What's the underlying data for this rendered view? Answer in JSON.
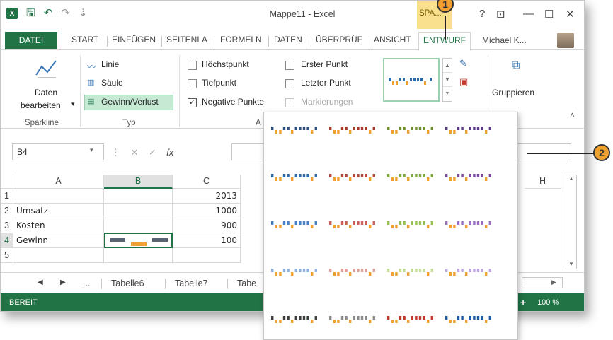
{
  "window": {
    "title": "Mappe11 - Excel",
    "context_label": "SPA...",
    "help": "?",
    "user": "Michael K...",
    "controls": [
      "—",
      "☐",
      "✕"
    ]
  },
  "qat": {
    "undo": "↶",
    "redo": "↷",
    "customize": "⇣"
  },
  "tabs": [
    {
      "label": "DATEI"
    },
    {
      "label": "START"
    },
    {
      "label": "EINFÜGEN"
    },
    {
      "label": "SEITENLA"
    },
    {
      "label": "FORMELN"
    },
    {
      "label": "DATEN"
    },
    {
      "label": "ÜBERPRÜF"
    },
    {
      "label": "ANSICHT"
    },
    {
      "label": "ENTWURF"
    }
  ],
  "ribbon": {
    "sparkline_group": {
      "edit_data": "Daten",
      "edit_data2": "bearbeiten",
      "label": "Sparkline"
    },
    "type_group": {
      "label": "Typ",
      "items": [
        {
          "label": "Linie",
          "icon": "line-chart-icon"
        },
        {
          "label": "Säule",
          "icon": "column-chart-icon"
        },
        {
          "label": "Gewinn/Verlust",
          "icon": "win-loss-icon"
        }
      ]
    },
    "show_group": {
      "label": "A",
      "checkboxes": [
        {
          "label": "Höchstpunkt",
          "checked": false,
          "disabled": false
        },
        {
          "label": "Tiefpunkt",
          "checked": false,
          "disabled": false
        },
        {
          "label": "Negative Punkte",
          "checked": true,
          "disabled": false
        },
        {
          "label": "Erster Punkt",
          "checked": false,
          "disabled": false
        },
        {
          "label": "Letzter Punkt",
          "checked": false,
          "disabled": false
        },
        {
          "label": "Markierungen",
          "checked": false,
          "disabled": true
        }
      ]
    },
    "group_label": "Gruppieren"
  },
  "formula_bar": {
    "namebox": "B4",
    "fx": "fx",
    "cancel": "✕",
    "enter": "✓"
  },
  "grid": {
    "columns": [
      "A",
      "B",
      "C",
      "H"
    ],
    "rows": [
      {
        "num": "1",
        "a": "",
        "c": "2013"
      },
      {
        "num": "2",
        "a": "Umsatz",
        "c": "1000"
      },
      {
        "num": "3",
        "a": "Kosten",
        "c": "900"
      },
      {
        "num": "4",
        "a": "Gewinn",
        "c": "100"
      },
      {
        "num": "5",
        "a": "",
        "c": ""
      }
    ]
  },
  "sheet_tabs": [
    "...",
    "Tabelle6",
    "Tabelle7",
    "Tabe"
  ],
  "status": {
    "text": "BEREIT",
    "zoom": "100 %",
    "plus": "+"
  },
  "callouts": [
    "1",
    "2"
  ],
  "colors": {
    "excel_green": "#217346",
    "gallery_rows": [
      [
        "#2f4e7b",
        "#a33a2c",
        "#6f8f2f",
        "#5a3c82"
      ],
      [
        "#2e6aa8",
        "#b4463e",
        "#7ea83a",
        "#7a4a9e"
      ],
      [
        "#4a7fc2",
        "#c66057",
        "#94c052",
        "#9a6fc2"
      ],
      [
        "#8fb0dd",
        "#e0a09a",
        "#c2dc95",
        "#bda7de"
      ],
      [
        "#3d3d3d",
        "#8a8a8a",
        "#c0392b",
        "#1d5aa6"
      ]
    ],
    "accent": "#f0a030"
  }
}
